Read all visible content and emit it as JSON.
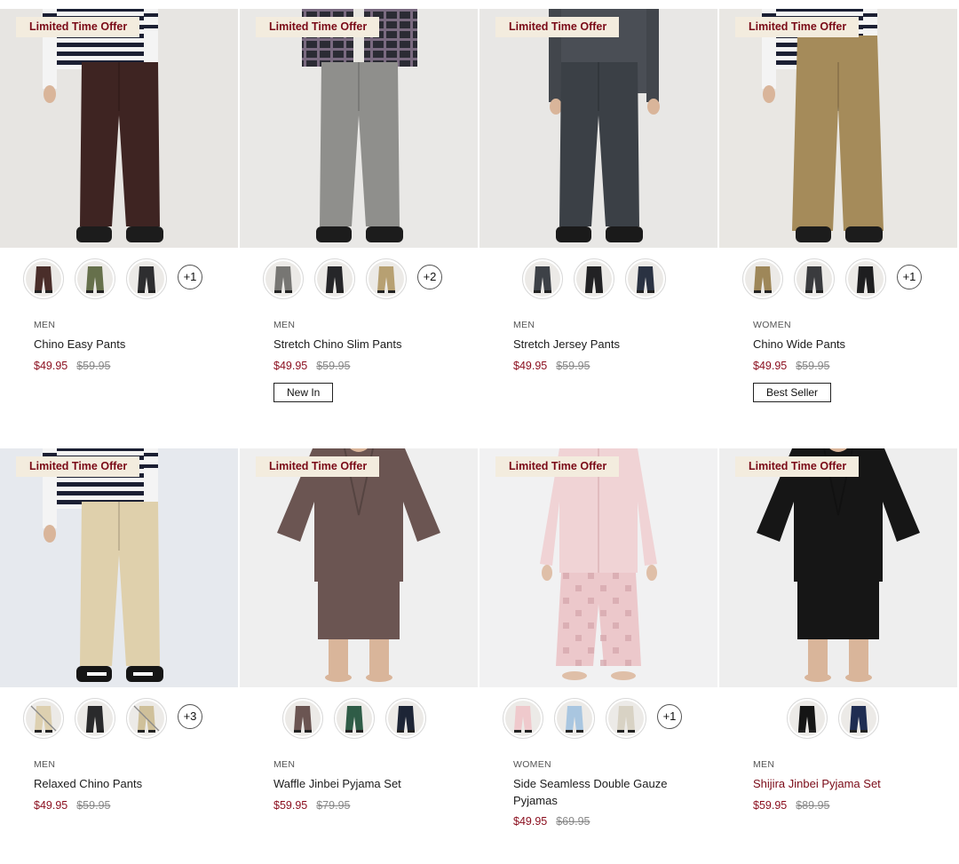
{
  "products": [
    {
      "badge": "Limited Time Offer",
      "category": "MEN",
      "name": "Chino Easy Pants",
      "sale_price": "$49.95",
      "original_price": "$59.95",
      "more_colors": "+1",
      "tag": "",
      "name_highlight": false,
      "photo": {
        "bg": "#e7e5e2",
        "top": "stripe",
        "pants": "#3e2422",
        "shoes": "#1c1c1c"
      },
      "swatch_colors": [
        "#4a2e2a",
        "#66704b",
        "#2e2e30"
      ]
    },
    {
      "badge": "Limited Time Offer",
      "category": "MEN",
      "name": "Stretch Chino Slim Pants",
      "sale_price": "$49.95",
      "original_price": "$59.95",
      "more_colors": "+2",
      "tag": "New In",
      "name_highlight": false,
      "photo": {
        "bg": "#e9e8e6",
        "top": "plaid",
        "pants": "#8f8f8c",
        "shoes": "#1c1c1c"
      },
      "swatch_colors": [
        "#777673",
        "#262629",
        "#b7a072"
      ]
    },
    {
      "badge": "Limited Time Offer",
      "category": "MEN",
      "name": "Stretch Jersey Pants",
      "sale_price": "$49.95",
      "original_price": "$59.95",
      "more_colors": "",
      "tag": "",
      "name_highlight": false,
      "photo": {
        "bg": "#e8e7e5",
        "top": "jacket",
        "pants": "#3b4046",
        "shoes": "#1a1a1a"
      },
      "swatch_colors": [
        "#3d4147",
        "#222224",
        "#2a3242"
      ]
    },
    {
      "badge": "Limited Time Offer",
      "category": "WOMEN",
      "name": "Chino Wide Pants",
      "sale_price": "$49.95",
      "original_price": "$59.95",
      "more_colors": "+1",
      "tag": "Best Seller",
      "name_highlight": false,
      "photo": {
        "bg": "#e9e7e3",
        "top": "stripe",
        "pants": "#a58b5a",
        "shoes": "#1c1c1c"
      },
      "swatch_colors": [
        "#9e8759",
        "#3a3b3e",
        "#1e1e20"
      ]
    },
    {
      "badge": "Limited Time Offer",
      "category": "MEN",
      "name": "Relaxed Chino Pants",
      "sale_price": "$49.95",
      "original_price": "$59.95",
      "more_colors": "+3",
      "tag": "",
      "name_highlight": false,
      "photo": {
        "bg": "#e6e9ee",
        "top": "stripe",
        "pants": "#dfd0ac",
        "shoes": "#151515"
      },
      "swatch_colors": [
        "#ddd0b0",
        "#2a2a2c",
        "#cfc09a"
      ],
      "swatch_na": [
        true,
        false,
        true
      ]
    },
    {
      "badge": "Limited Time Offer",
      "category": "MEN",
      "name": "Waffle Jinbei Pyjama Set",
      "sale_price": "$59.95",
      "original_price": "$79.95",
      "more_colors": "",
      "tag": "",
      "name_highlight": false,
      "photo": {
        "bg": "#efefef",
        "top": "jinbei",
        "pants": "#6b5552",
        "shoes": "none"
      },
      "swatch_colors": [
        "#6b5552",
        "#2f5c47",
        "#1d2536"
      ]
    },
    {
      "badge": "Limited Time Offer",
      "category": "WOMEN",
      "name": "Side Seamless Double Gauze Pyjamas",
      "sale_price": "$49.95",
      "original_price": "$69.95",
      "more_colors": "+1",
      "tag": "",
      "name_highlight": false,
      "photo": {
        "bg": "#f1f1f2",
        "top": "pyjama",
        "pants": "#ecc8cb",
        "shoes": "none"
      },
      "swatch_colors": [
        "#efc9cc",
        "#a9c6e0",
        "#d8d2c4"
      ]
    },
    {
      "badge": "Limited Time Offer",
      "category": "MEN",
      "name": "Shijira Jinbei Pyjama Set",
      "sale_price": "$59.95",
      "original_price": "$89.95",
      "more_colors": "",
      "tag": "",
      "name_highlight": true,
      "photo": {
        "bg": "#eeeeee",
        "top": "jinbei",
        "pants": "#161616",
        "shoes": "none"
      },
      "swatch_colors": [
        "#151515",
        "#1f2d52"
      ]
    }
  ],
  "colors": {
    "sale_red": "#8a0d1d",
    "badge_bg": "#f3ecde",
    "badge_text": "#7a0a17"
  }
}
